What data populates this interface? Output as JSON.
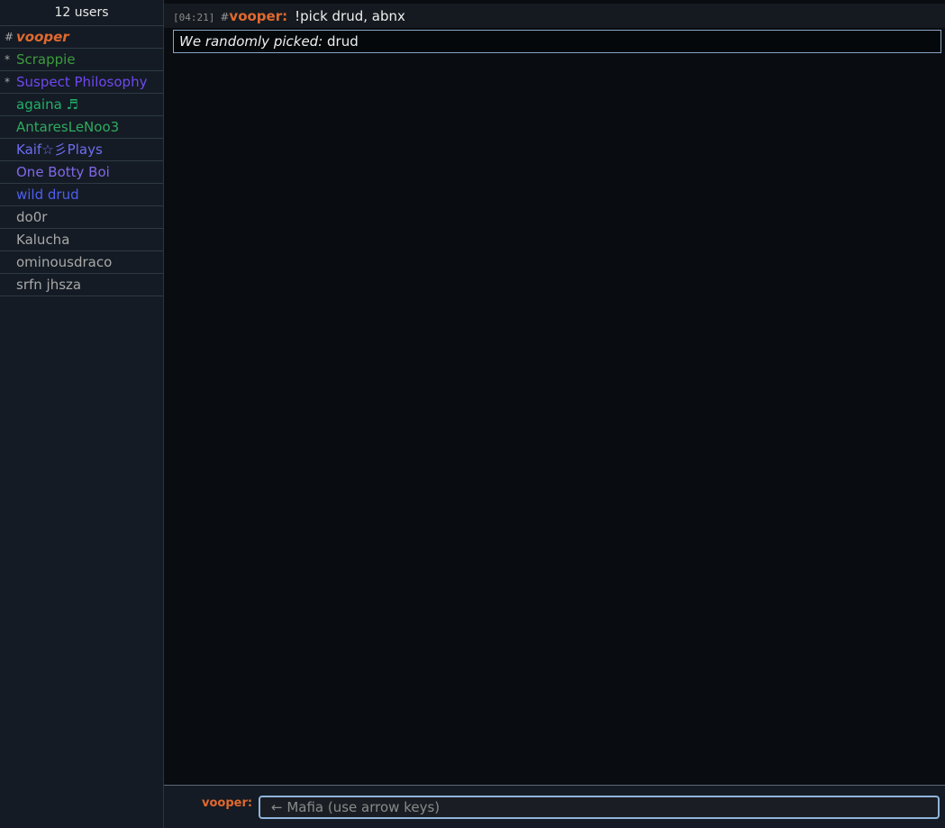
{
  "userlist": {
    "header": "12 users",
    "users": [
      {
        "rank": "#",
        "name": "vooper",
        "color": "#e0692e",
        "self": true
      },
      {
        "rank": "*",
        "name": "Scrappie",
        "color": "#3d9c3d"
      },
      {
        "rank": "*",
        "name": "Suspect Philosophy",
        "color": "#6f48f0"
      },
      {
        "rank": "",
        "name": "againa ♬",
        "color": "#22b068"
      },
      {
        "rank": "",
        "name": "AntaresLeNoo3",
        "color": "#2faa5e"
      },
      {
        "rank": "",
        "name": "Kaif☆彡Plays",
        "color": "#6e6ef0"
      },
      {
        "rank": "",
        "name": "One Botty Boi",
        "color": "#8068e8"
      },
      {
        "rank": "",
        "name": "wild drud",
        "color": "#4f5ef0"
      },
      {
        "rank": "",
        "name": "do0r",
        "color": "#a8a8a8"
      },
      {
        "rank": "",
        "name": "Kalucha",
        "color": "#a8a8a8"
      },
      {
        "rank": "",
        "name": "ominousdraco",
        "color": "#a8a8a8"
      },
      {
        "rank": "",
        "name": "srfn jhsza",
        "color": "#a8a8a8"
      }
    ]
  },
  "chat": {
    "message": {
      "timestamp": "[04:21]",
      "rank": "#",
      "author": "vooper:",
      "text": "!pick drud, abnx"
    },
    "infobox": {
      "label": "We randomly picked:",
      "value": "drud"
    }
  },
  "input": {
    "user_label": "vooper:",
    "placeholder": "← Mafia (use arrow keys)"
  }
}
